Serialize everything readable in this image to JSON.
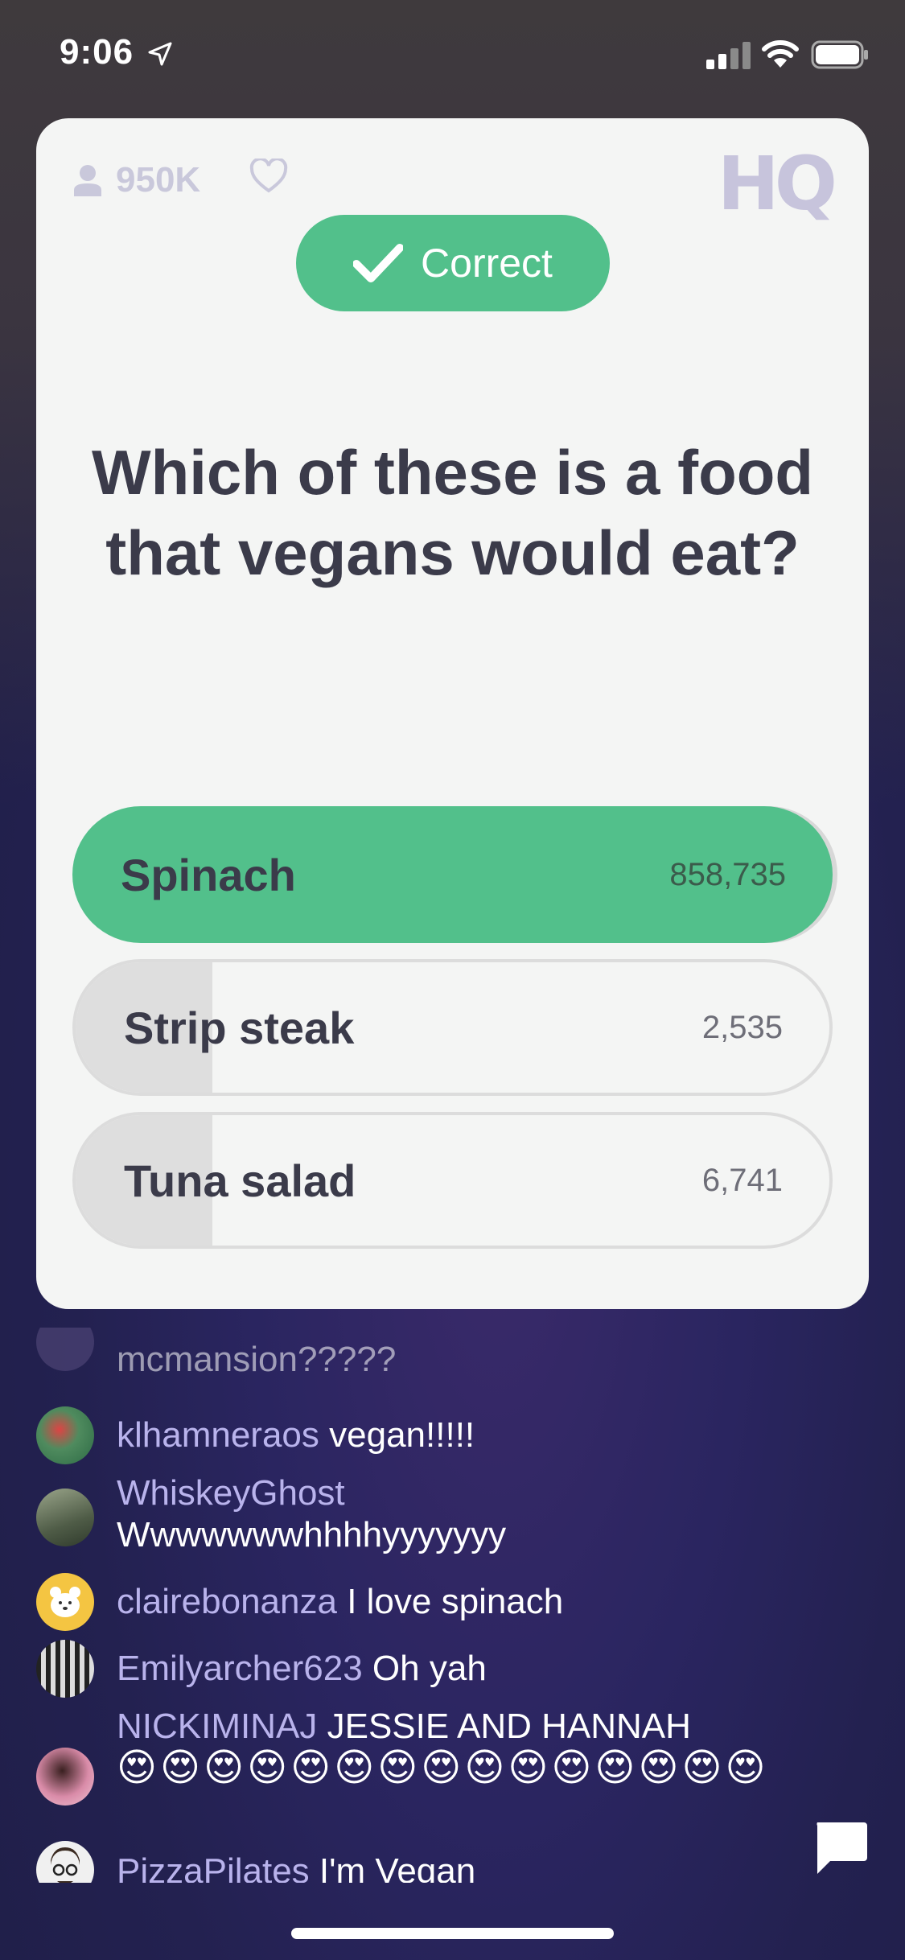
{
  "status_bar": {
    "time": "9:06",
    "icons": [
      "location-arrow-icon",
      "signal-icon",
      "wifi-icon",
      "battery-icon"
    ]
  },
  "card": {
    "viewers": "950K",
    "logo": "HQ",
    "result_label": "Correct",
    "question": "Which of these is a food that vegans would eat?",
    "answers": [
      {
        "label": "Spinach",
        "count": "858,735",
        "share": 0.98,
        "correct": true
      },
      {
        "label": "Strip steak",
        "count": "2,535",
        "share": 0.18,
        "correct": false
      },
      {
        "label": "Tuna salad",
        "count": "6,741",
        "share": 0.18,
        "correct": false
      }
    ]
  },
  "chat": [
    {
      "user": "",
      "text": "mcmansion?????",
      "avatar_color": "#5a4f80"
    },
    {
      "user": "klhamneraos",
      "text": "vegan!!!!!",
      "avatar_color": "#4f8b5e"
    },
    {
      "user": "WhiskeyGhost",
      "text": "Wwwwwwwhhhhyyyyyyy",
      "avatar_color": "#5a6a55"
    },
    {
      "user": "clairebonanza",
      "text": "I love spinach",
      "avatar_color": "#f4c542"
    },
    {
      "user": "Emilyarcher623",
      "text": "Oh yah",
      "avatar_color": "#888888"
    },
    {
      "user": "NICKIMINAJ",
      "text": "JESSIE AND HANNAH",
      "emojis": "😍😍😍😍😍😍😍😍😍😍😍😍😍😍😍",
      "avatar_color": "#d98ba8"
    },
    {
      "user": "PizzaPilates",
      "text": "I'm Vegan",
      "avatar_color": "#f0f0f0"
    }
  ],
  "colors": {
    "accent_green": "#52c08b",
    "card_bg": "#f4f5f4",
    "text_dark": "#3b3b4a",
    "username": "#b9b3ec"
  }
}
